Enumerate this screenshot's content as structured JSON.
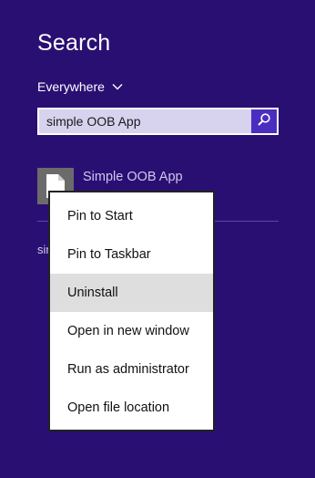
{
  "search_pane": {
    "title": "Search",
    "scope": {
      "label": "Everywhere"
    },
    "search_box": {
      "value": "simple OOB App"
    },
    "results": [
      {
        "label": "Simple OOB App"
      }
    ],
    "partial_text": "simple OOB App"
  },
  "context_menu": {
    "items": [
      {
        "label": "Pin to Start"
      },
      {
        "label": "Pin to Taskbar"
      },
      {
        "label": "Uninstall"
      },
      {
        "label": "Open in new window"
      },
      {
        "label": "Run as administrator"
      },
      {
        "label": "Open file location"
      }
    ],
    "highlighted_item": "Uninstall"
  },
  "colors": {
    "background": "#2a0f73",
    "search_button": "#4a2ec0",
    "search_box": "#d7d2ee",
    "highlight": "#dedede"
  },
  "icons": {
    "scope_dropdown": "chevron-down-icon",
    "search_button": "search-icon",
    "app_tile": "document-icon"
  }
}
